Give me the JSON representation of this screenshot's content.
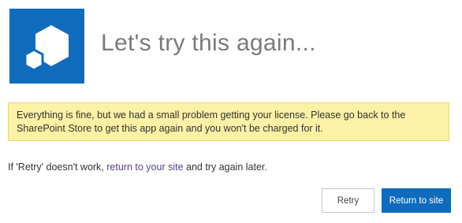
{
  "header": {
    "title": "Let's try this again...",
    "icon": "sharepoint-app-cube-icon",
    "icon_bg_color": "#0f6cbd"
  },
  "warning": {
    "message": "Everything is fine, but we had a small problem getting your license. Please go back to the SharePoint Store to get this app again and you won't be charged for it.",
    "bg_color": "#fcf1a4"
  },
  "hint": {
    "prefix": "If 'Retry' doesn't work, ",
    "link_text": "return to your site",
    "suffix": " and try again later."
  },
  "buttons": {
    "retry_label": "Retry",
    "return_label": "Return to site",
    "primary_color": "#0f6cbd"
  }
}
